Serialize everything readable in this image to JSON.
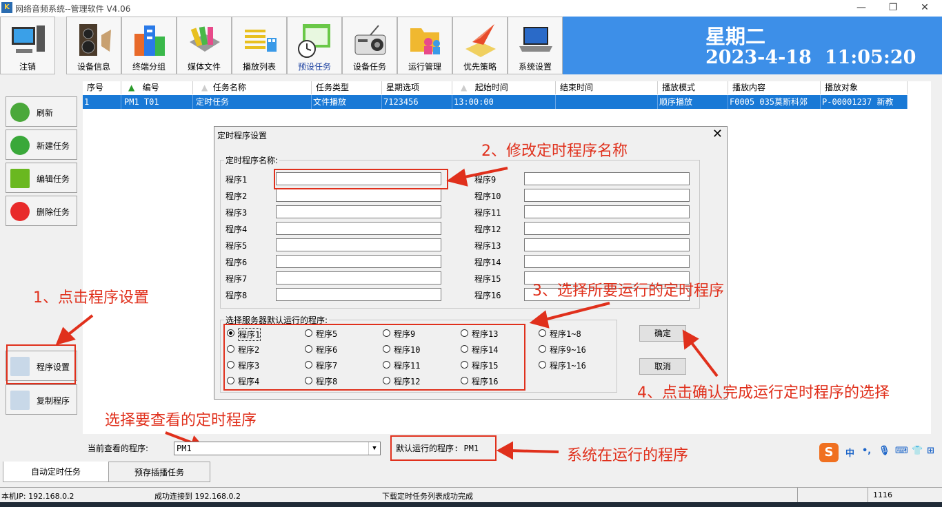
{
  "window": {
    "title": "网络音频系统--管理软件   V4.06",
    "minimize": "—",
    "restore": "❐",
    "close": "✕"
  },
  "toolbar": [
    {
      "label": "注销",
      "icon": "computer-icon"
    },
    {
      "label": "设备信息",
      "icon": "speaker-icon"
    },
    {
      "label": "终端分组",
      "icon": "buildings-icon"
    },
    {
      "label": "媒体文件",
      "icon": "books-icon"
    },
    {
      "label": "播放列表",
      "icon": "list-icon"
    },
    {
      "label": "预设任务",
      "icon": "calendar-clock-icon"
    },
    {
      "label": "设备任务",
      "icon": "radio-icon"
    },
    {
      "label": "运行管理",
      "icon": "folder-people-icon"
    },
    {
      "label": "优先策略",
      "icon": "paper-plane-book-icon"
    },
    {
      "label": "系统设置",
      "icon": "laptop-icon"
    }
  ],
  "datetime": {
    "weekday": "星期二",
    "date": "2023-4-18",
    "time": "11:05:20"
  },
  "sidebar": {
    "refresh": "刷新",
    "new_task": "新建任务",
    "edit_task": "编辑任务",
    "delete_task": "删除任务",
    "program_settings": "程序设置",
    "copy_program": "复制程序"
  },
  "table": {
    "headers": [
      "序号",
      "编号",
      "任务名称",
      "任务类型",
      "星期选项",
      "起始时间",
      "结束时间",
      "播放模式",
      "播放内容",
      "播放对象"
    ],
    "rows": [
      [
        "1",
        "PM1 T01",
        "定时任务",
        "文件播放",
        "7123456",
        "13:00:00",
        "",
        "顺序播放",
        "F0005 035莫斯科郊",
        "P-00001237  新教"
      ]
    ]
  },
  "dialog": {
    "title": "定时程序设置",
    "close": "✕",
    "names_group": "定时程序名称:",
    "programs_left": [
      "程序1",
      "程序2",
      "程序3",
      "程序4",
      "程序5",
      "程序6",
      "程序7",
      "程序8"
    ],
    "programs_right": [
      "程序9",
      "程序10",
      "程序11",
      "程序12",
      "程序13",
      "程序14",
      "程序15",
      "程序16"
    ],
    "select_group": "选择服务器默认运行的程序:",
    "radio_cols": [
      [
        "程序1",
        "程序2",
        "程序3",
        "程序4"
      ],
      [
        "程序5",
        "程序6",
        "程序7",
        "程序8"
      ],
      [
        "程序9",
        "程序10",
        "程序11",
        "程序12"
      ],
      [
        "程序13",
        "程序14",
        "程序15",
        "程序16"
      ],
      [
        "程序1~8",
        "程序9~16",
        "程序1~16"
      ]
    ],
    "selected": "程序1",
    "ok": "确定",
    "cancel": "取消"
  },
  "bottom": {
    "current_label": "当前查看的程序:",
    "current_value": "PM1",
    "default_running": "默认运行的程序: PM1"
  },
  "tabs": [
    "自动定时任务",
    "预存插播任务"
  ],
  "status": {
    "ip": "本机IP: 192.168.0.2",
    "connected": "成功连接到 192.168.0.2",
    "download": "下载定时任务列表成功完成",
    "code": "1116"
  },
  "annotations": {
    "step1": "1、点击程序设置",
    "step2": "2、修改定时程序名称",
    "step3": "3、选择所要运行的定时程序",
    "step4": "4、点击确认完成运行定时程序的选择",
    "select_view": "选择要查看的定时程序",
    "running": "系统在运行的程序"
  },
  "ime": {
    "logo": "S",
    "items": [
      "中",
      "•,",
      "🎙",
      "⌨",
      "👕",
      "⊞"
    ]
  },
  "colors": {
    "accent_blue": "#3d8fe8",
    "selection": "#1979d6",
    "annotation_red": "#e0301c"
  }
}
